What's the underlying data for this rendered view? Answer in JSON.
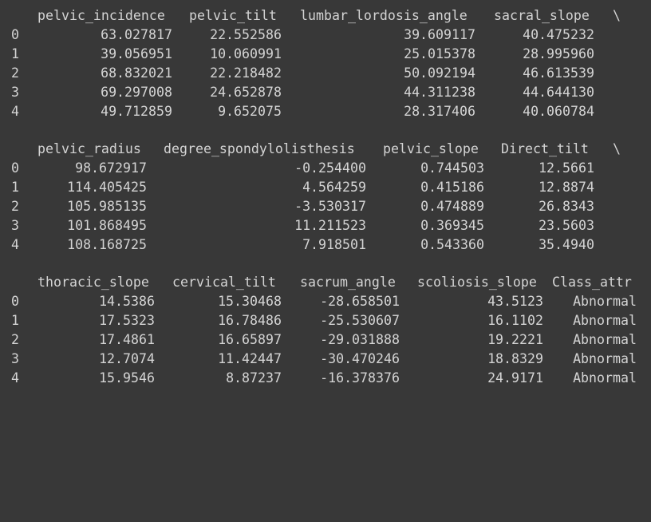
{
  "output": {
    "continuation_mark": "\\",
    "block1": {
      "headers": [
        "pelvic_incidence",
        "pelvic_tilt",
        "lumbar_lordosis_angle",
        "sacral_slope"
      ],
      "rows": [
        {
          "index": "0",
          "values": [
            "63.027817",
            "22.552586",
            "39.609117",
            "40.475232"
          ]
        },
        {
          "index": "1",
          "values": [
            "39.056951",
            "10.060991",
            "25.015378",
            "28.995960"
          ]
        },
        {
          "index": "2",
          "values": [
            "68.832021",
            "22.218482",
            "50.092194",
            "46.613539"
          ]
        },
        {
          "index": "3",
          "values": [
            "69.297008",
            "24.652878",
            "44.311238",
            "44.644130"
          ]
        },
        {
          "index": "4",
          "values": [
            "49.712859",
            "9.652075",
            "28.317406",
            "40.060784"
          ]
        }
      ]
    },
    "block2": {
      "headers": [
        "pelvic_radius",
        "degree_spondylolisthesis",
        "pelvic_slope",
        "Direct_tilt"
      ],
      "rows": [
        {
          "index": "0",
          "values": [
            "98.672917",
            "-0.254400",
            "0.744503",
            "12.5661"
          ]
        },
        {
          "index": "1",
          "values": [
            "114.405425",
            "4.564259",
            "0.415186",
            "12.8874"
          ]
        },
        {
          "index": "2",
          "values": [
            "105.985135",
            "-3.530317",
            "0.474889",
            "26.8343"
          ]
        },
        {
          "index": "3",
          "values": [
            "101.868495",
            "11.211523",
            "0.369345",
            "23.5603"
          ]
        },
        {
          "index": "4",
          "values": [
            "108.168725",
            "7.918501",
            "0.543360",
            "35.4940"
          ]
        }
      ]
    },
    "block3": {
      "headers": [
        "thoracic_slope",
        "cervical_tilt",
        "sacrum_angle",
        "scoliosis_slope",
        "Class_attr"
      ],
      "rows": [
        {
          "index": "0",
          "values": [
            "14.5386",
            "15.30468",
            "-28.658501",
            "43.5123",
            "Abnormal"
          ]
        },
        {
          "index": "1",
          "values": [
            "17.5323",
            "16.78486",
            "-25.530607",
            "16.1102",
            "Abnormal"
          ]
        },
        {
          "index": "2",
          "values": [
            "17.4861",
            "16.65897",
            "-29.031888",
            "19.2221",
            "Abnormal"
          ]
        },
        {
          "index": "3",
          "values": [
            "12.7074",
            "11.42447",
            "-30.470246",
            "18.8329",
            "Abnormal"
          ]
        },
        {
          "index": "4",
          "values": [
            "15.9546",
            "8.87237",
            "-16.378376",
            "24.9171",
            "Abnormal"
          ]
        }
      ]
    }
  }
}
